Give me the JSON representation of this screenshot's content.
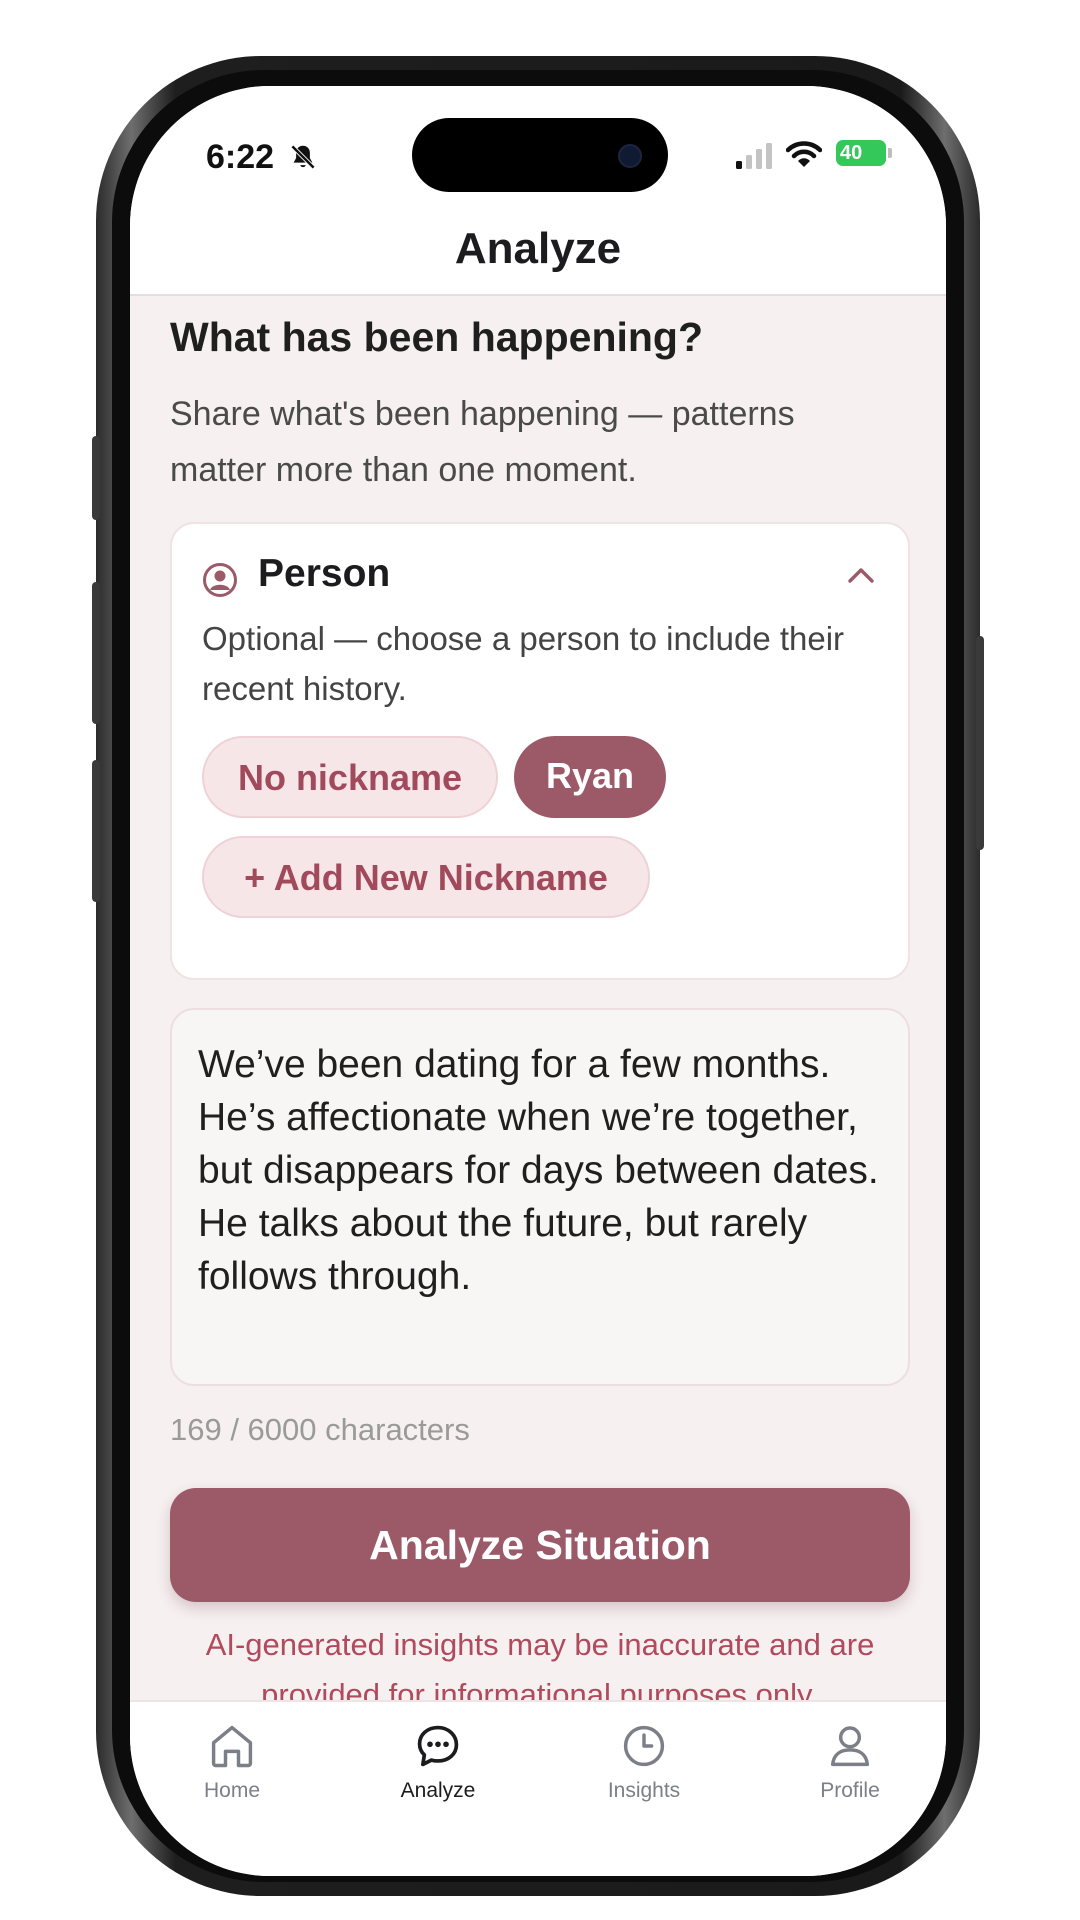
{
  "status_bar": {
    "time": "6:22",
    "battery": "40"
  },
  "header": {
    "title": "Analyze"
  },
  "section": {
    "title": "What has been happening?",
    "subtitle": "Share what's been happening — patterns matter more than one moment."
  },
  "person_card": {
    "title": "Person",
    "subtitle": "Optional — choose a person to include their recent history.",
    "chips": [
      "No nickname",
      "Ryan"
    ],
    "selected_chip": "Ryan",
    "add_label": "+ Add New Nickname"
  },
  "input": {
    "value": "We’ve been dating for a few months. He’s affectionate when we’re together, but disappears for days between dates. He talks about the future, but rarely follows through.",
    "char_count": "169 / 6000 characters"
  },
  "actions": {
    "analyze_label": "Analyze Situation"
  },
  "disclaimer": "AI-generated insights may be inaccurate and are provided for informational purposes only.",
  "tabbar": {
    "items": [
      {
        "label": "Home",
        "icon": "home-icon"
      },
      {
        "label": "Analyze",
        "icon": "chat-bubble-icon"
      },
      {
        "label": "Insights",
        "icon": "clock-icon"
      },
      {
        "label": "Profile",
        "icon": "person-icon"
      }
    ],
    "active": "Analyze"
  },
  "colors": {
    "accent": "#9c5968",
    "chip_bg": "#f7e6e8",
    "background": "#f6f0f0",
    "disclaimer": "#b04a5d"
  }
}
